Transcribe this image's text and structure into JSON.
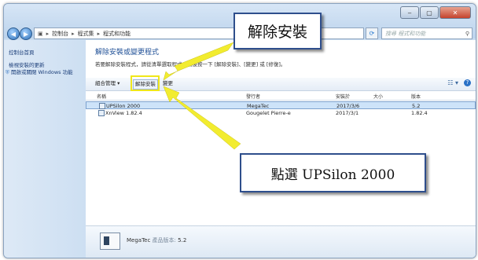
{
  "window": {
    "controls": [
      "‒",
      "▢",
      "✕"
    ]
  },
  "address": {
    "crumbs": [
      "控制台",
      "程式集",
      "程式和功能"
    ],
    "search_placeholder": "搜尋 程式和功能"
  },
  "sidebar": {
    "items": [
      {
        "label": "控制台首頁",
        "icon": ""
      },
      {
        "label": "檢視安裝的更新",
        "icon": ""
      },
      {
        "label": "開啟或關閉 Windows 功能",
        "icon": "shield-icon"
      }
    ]
  },
  "main": {
    "heading": "解除安裝或變更程式",
    "description": "若要解除安裝程式，請從清單選取程式，然後按一下 [解除安裝]、[變更] 或 [修復]。"
  },
  "toolbar": {
    "organize": "組合管理 ▾",
    "uninstall": "解除安裝",
    "change": "變更"
  },
  "table": {
    "columns": [
      "名稱",
      "發行者",
      "安裝於",
      "大小",
      "版本"
    ],
    "rows": [
      {
        "name": "UPSilon 2000",
        "publisher": "MegaTec",
        "installed": "2017/3/6",
        "size": "",
        "version": "5.2",
        "selected": true
      },
      {
        "name": "XnView 1.82.4",
        "publisher": "Gougelet Pierre-e",
        "installed": "2017/3/1",
        "size": "",
        "version": "1.82.4",
        "selected": false
      }
    ]
  },
  "status": {
    "publisher": "MegaTec",
    "version_label": "產品版本:",
    "version": "5.2"
  },
  "callouts": {
    "uninstall": "解除安裝",
    "select": "點選 UPSilon 2000"
  },
  "colors": {
    "highlight": "#f0e71a",
    "arrow": "#f2ec2f",
    "callout_border": "#2e4e8c",
    "selected_row": "#cde3f9"
  }
}
